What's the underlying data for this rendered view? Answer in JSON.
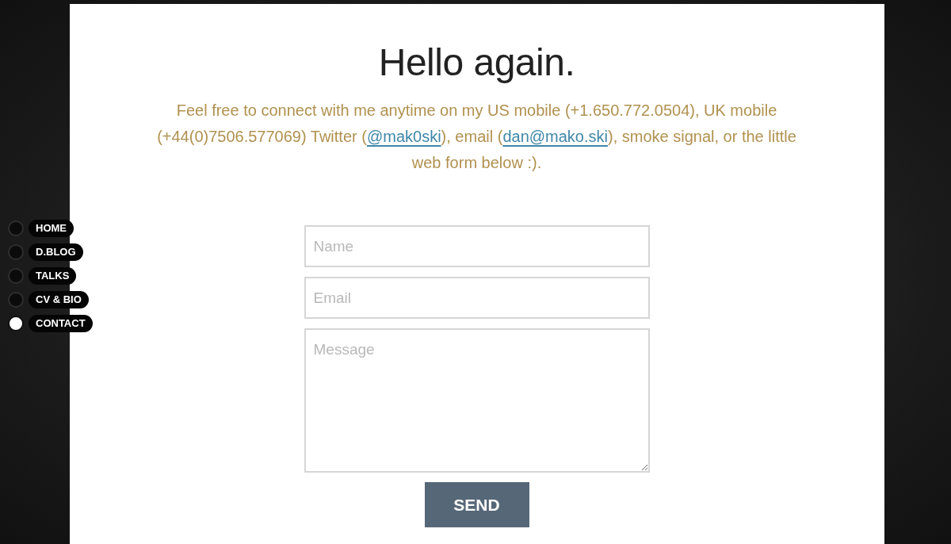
{
  "nav": [
    {
      "label": "HOME",
      "selected": false
    },
    {
      "label": "D.BLOG",
      "selected": false
    },
    {
      "label": "TALKS",
      "selected": false
    },
    {
      "label": "CV & BIO",
      "selected": false
    },
    {
      "label": "CONTACT",
      "selected": true
    }
  ],
  "heading": "Hello again.",
  "intro": [
    {
      "kind": "text",
      "text": "Feel free to connect with me anytime on my US mobile (+1.650.772.0504), UK mobile (+44(0)7506.577069) Twitter ("
    },
    {
      "kind": "link",
      "text": "@mak0ski"
    },
    {
      "kind": "text",
      "text": "), email ("
    },
    {
      "kind": "link",
      "text": "dan@mako.ski"
    },
    {
      "kind": "text",
      "text": "), smoke signal, or the little web form below :)."
    }
  ],
  "form": {
    "name": {
      "placeholder": "Name"
    },
    "email": {
      "placeholder": "Email"
    },
    "message": {
      "placeholder": "Message"
    },
    "submit": "SEND"
  }
}
